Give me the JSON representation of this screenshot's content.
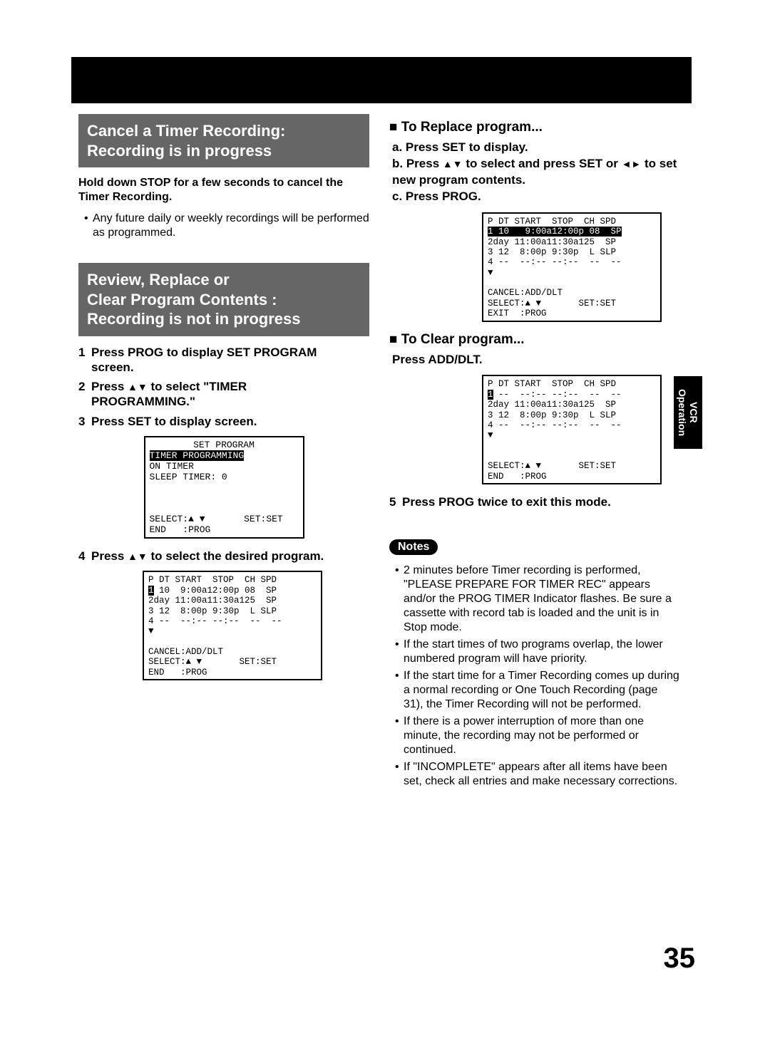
{
  "headings": {
    "cancel": "Cancel a Timer Recording:\nRecording is in progress",
    "review": "Review, Replace or\nClear Program Contents :\nRecording is not in progress"
  },
  "left": {
    "hold_down": "Hold down STOP for a few seconds to cancel the Timer Recording.",
    "future_note": "Any future daily or weekly recordings will be performed as programmed.",
    "step1": "Press PROG to display SET PROGRAM screen.",
    "step2a": "Press ",
    "step2b": " to select \"TIMER PROGRAMMING.\"",
    "step3": "Press SET to display screen.",
    "step4a": "Press ",
    "step4b": " to select the desired program."
  },
  "osd1": {
    "title": "SET PROGRAM",
    "line_hl": "TIMER PROGRAMMING",
    "line2": "ON TIMER",
    "line3": "SLEEP TIMER: 0",
    "sel": "SELECT:▲ ▼       SET:SET",
    "end": "END   :PROG"
  },
  "osd2": {
    "hdr": "P DT START  STOP  CH SPD",
    "r1a": "1",
    "r1b": " 10  9:00a12:00p 08  SP",
    "r2": "2day 11:00a11:30a125  SP",
    "r3": "3 12  8:00p 9:30p  L SLP",
    "r4": "4 --  --:-- --:--  --  --",
    "dn": "▼",
    "cancel": "CANCEL:ADD/DLT",
    "sel": "SELECT:▲ ▼       SET:SET",
    "end": "END   :PROG"
  },
  "right": {
    "replace_title": "To Replace program...",
    "ra": "a. Press SET to display.",
    "rb1": "b. Press ",
    "rb2": " to select and press SET or ",
    "rb3": " to set new program contents.",
    "rc": "c. Press PROG.",
    "clear_title": "To Clear program...",
    "clear_sub": "Press ADD/DLT.",
    "step5": "Press PROG twice to exit this mode."
  },
  "osd3": {
    "hdr": "P DT START  STOP  CH SPD",
    "r1a": "1",
    "r1b_hl": " 10   9:00a12:00p 08  SP",
    "r2": "2day 11:00a11:30a125  SP",
    "r3": "3 12  8:00p 9:30p  L SLP",
    "r4": "4 --  --:-- --:--  --  --",
    "dn": "▼",
    "cancel": "CANCEL:ADD/DLT",
    "sel": "SELECT:▲ ▼       SET:SET",
    "exit": "EXIT  :PROG"
  },
  "osd4": {
    "hdr": "P DT START  STOP  CH SPD",
    "r1a": "1",
    "r1b": " --  --:-- --:--  --  --",
    "r2": "2day 11:00a11:30a125  SP",
    "r3": "3 12  8:00p 9:30p  L SLP",
    "r4": "4 --  --:-- --:--  --  --",
    "dn": "▼",
    "sel": "SELECT:▲ ▼       SET:SET",
    "end": "END   :PROG"
  },
  "notes_label": "Notes",
  "notes": [
    "2 minutes before Timer recording is performed, \"PLEASE PREPARE FOR TIMER REC\" appears and/or the PROG TIMER Indicator flashes. Be sure a cassette with record tab is loaded and the unit is in Stop mode.",
    "If the start times of two programs overlap, the lower numbered program will have priority.",
    "If the start time for a Timer Recording comes up during a normal recording or One Touch Recording (page 31), the Timer Recording will not be performed.",
    "If there is a power interruption of more than one minute, the recording may not be performed or continued.",
    "If \"INCOMPLETE\" appears after all items have been set, check all entries and make necessary corrections."
  ],
  "side_tab": "VCR\nOperation",
  "page_number": "35"
}
